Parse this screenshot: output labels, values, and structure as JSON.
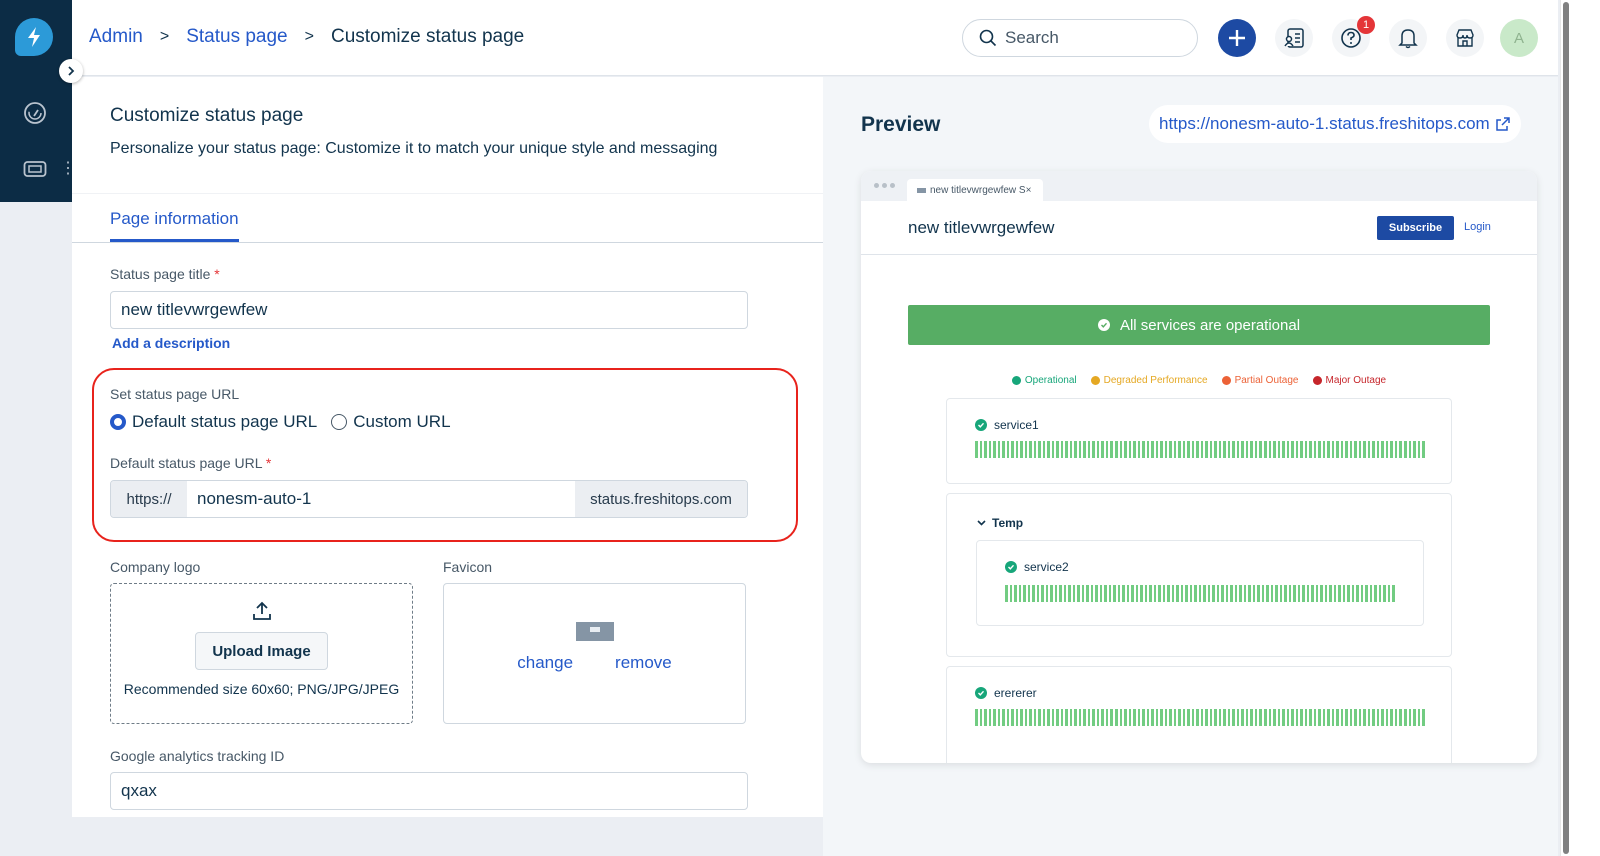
{
  "sidebar": {
    "brand": "Freshservice",
    "items": [
      {
        "icon": "speedometer-icon",
        "label": "Dashboard"
      },
      {
        "icon": "ticket-icon",
        "label": "Tickets"
      }
    ]
  },
  "header": {
    "breadcrumb": [
      {
        "label": "Admin",
        "link": true
      },
      {
        "label": "Status page",
        "link": true
      },
      {
        "label": "Customize status page",
        "link": false
      }
    ],
    "search_placeholder": "Search",
    "help_badge": "1",
    "avatar_initial": "A"
  },
  "page": {
    "title": "Customize status page",
    "description": "Personalize your status page: Customize it to match your unique style and messaging",
    "tabs": [
      {
        "label": "Page information",
        "active": true
      }
    ]
  },
  "form": {
    "title_label": "Status page title",
    "required_mark": "*",
    "title_value": "new titlevwrgewfew",
    "add_description": "Add a description",
    "url_section_label": "Set status page URL",
    "url_options": [
      {
        "label": "Default status page URL",
        "selected": true
      },
      {
        "label": "Custom URL",
        "selected": false
      }
    ],
    "default_url_label": "Default status page URL",
    "url_prefix": "https://",
    "url_value": "nonesm-auto-1",
    "url_suffix": "status.freshitops.com",
    "logo_label": "Company logo",
    "upload_button": "Upload Image",
    "upload_hint": "Recommended size 60x60; PNG/JPG/JPEG",
    "favicon_label": "Favicon",
    "favicon_change": "change",
    "favicon_remove": "remove",
    "ga_label": "Google analytics tracking ID",
    "ga_value": "qxax"
  },
  "preview": {
    "title": "Preview",
    "url": "https://nonesm-auto-1.status.freshitops.com",
    "browser_tab": "new titlevwrgewfew S×",
    "site_title": "new titlevwrgewfew",
    "subscribe": "Subscribe",
    "login": "Login",
    "banner": "All services are operational",
    "legend": [
      {
        "label": "Operational",
        "color": "#17a67a"
      },
      {
        "label": "Degraded Performance",
        "color": "#e5a823"
      },
      {
        "label": "Partial Outage",
        "color": "#ec6237"
      },
      {
        "label": "Major Outage",
        "color": "#c6262b"
      }
    ],
    "services": [
      {
        "name": "service1",
        "status": "Operational"
      },
      {
        "group": "Temp",
        "expanded": true,
        "services": [
          {
            "name": "service2",
            "status": "Operational"
          }
        ]
      },
      {
        "name": "erererer",
        "status": "Operational"
      }
    ]
  },
  "colors": {
    "primary": "#2559c9",
    "sidebar_bg": "#0c2c45",
    "operational": "#57ad64",
    "highlight": "#e8231c"
  }
}
